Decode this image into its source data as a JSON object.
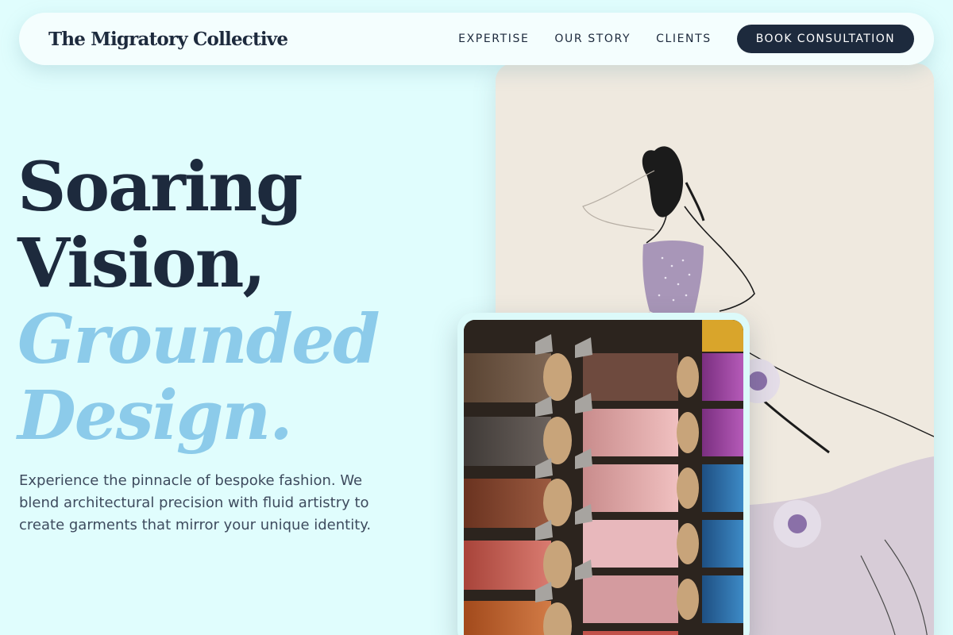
{
  "brand": {
    "name": "The Migratory Collective"
  },
  "nav": {
    "links": [
      "EXPERTISE",
      "OUR STORY",
      "CLIENTS"
    ],
    "cta": "BOOK CONSULTATION"
  },
  "hero": {
    "line1": "Soaring",
    "line2": "Vision,",
    "line3": "Grounded",
    "line4": "Design.",
    "subtitle": "Experience the pinnacle of bespoke fashion. We blend architectural precision with fluid artistry to create garments that mirror your unique identity."
  },
  "images": {
    "sketch_icon": "fashion-sketch-icon",
    "threads_icon": "thread-spools-icon"
  },
  "colors": {
    "background": "#e0fdfd",
    "navy": "#1d2a3d",
    "accent": "#8ccbea"
  }
}
